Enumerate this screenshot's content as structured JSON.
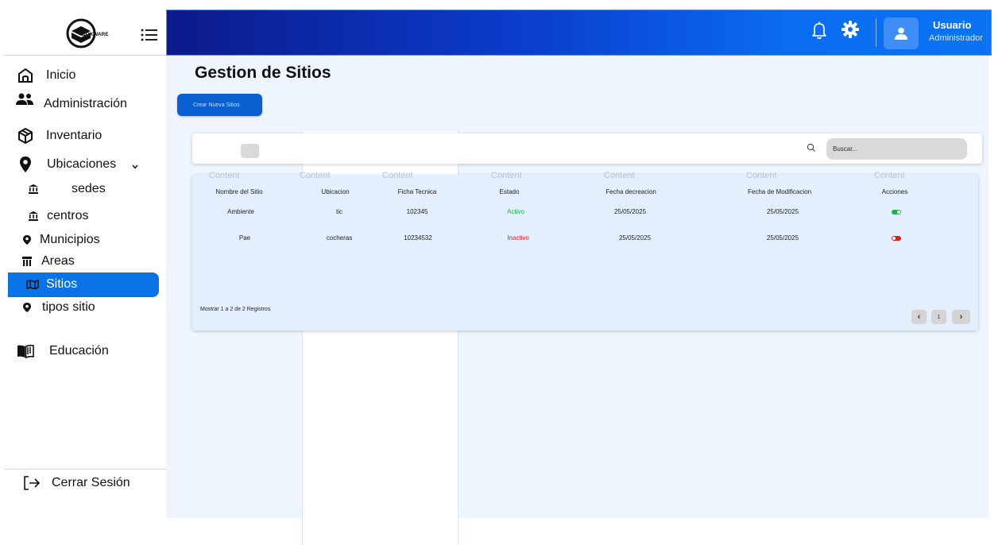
{
  "brand": {
    "logo_text": "BOXWARE"
  },
  "sidebar": {
    "items": [
      {
        "label": "Inicio"
      },
      {
        "label": "Administración"
      },
      {
        "label": "Inventario"
      },
      {
        "label": "Ubicaciones"
      }
    ],
    "sub_items": [
      {
        "label": "sedes"
      },
      {
        "label": "centros"
      },
      {
        "label": "Municipios"
      },
      {
        "label": "Areas"
      },
      {
        "label": "Sitios"
      },
      {
        "label": "tipos sitio"
      }
    ],
    "education": {
      "label": "Educación"
    },
    "logout": {
      "label": "Cerrar Sesión"
    },
    "active_color": "#0a73e8"
  },
  "header": {
    "user_name": "Usuario",
    "user_role": "Administrador"
  },
  "main": {
    "title": "Gestion de Sitios",
    "create_button": "Crear Nueva Sitios",
    "search": {
      "placeholder": "Buscar..."
    },
    "ghost_label": "Content",
    "table": {
      "columns": [
        "Nombre del Sitio",
        "Ubicacion",
        "Ficha Tecnica",
        "Estado",
        "Fecha decreacion",
        "Fecha de Modificacion",
        "Acciones"
      ],
      "rows": [
        {
          "nombre": "Ambiente",
          "ubicacion": "tic",
          "ficha": "102345",
          "estado": "Activo",
          "estado_color": "#22b14c",
          "creacion": "25/05/2025",
          "modificacion": "25/05/2025",
          "accion": "on"
        },
        {
          "nombre": "Pae",
          "ubicacion": "cocheras",
          "ficha": "10234532",
          "estado": "Inactivo",
          "estado_color": "#e02020",
          "creacion": "25/05/2025",
          "modificacion": "25/05/2025",
          "accion": "off"
        }
      ]
    },
    "footer_text": "Mostrar 1 a 2 de 2 Registros",
    "pagination": {
      "prev": "‹",
      "page": "1",
      "next": "›"
    }
  }
}
